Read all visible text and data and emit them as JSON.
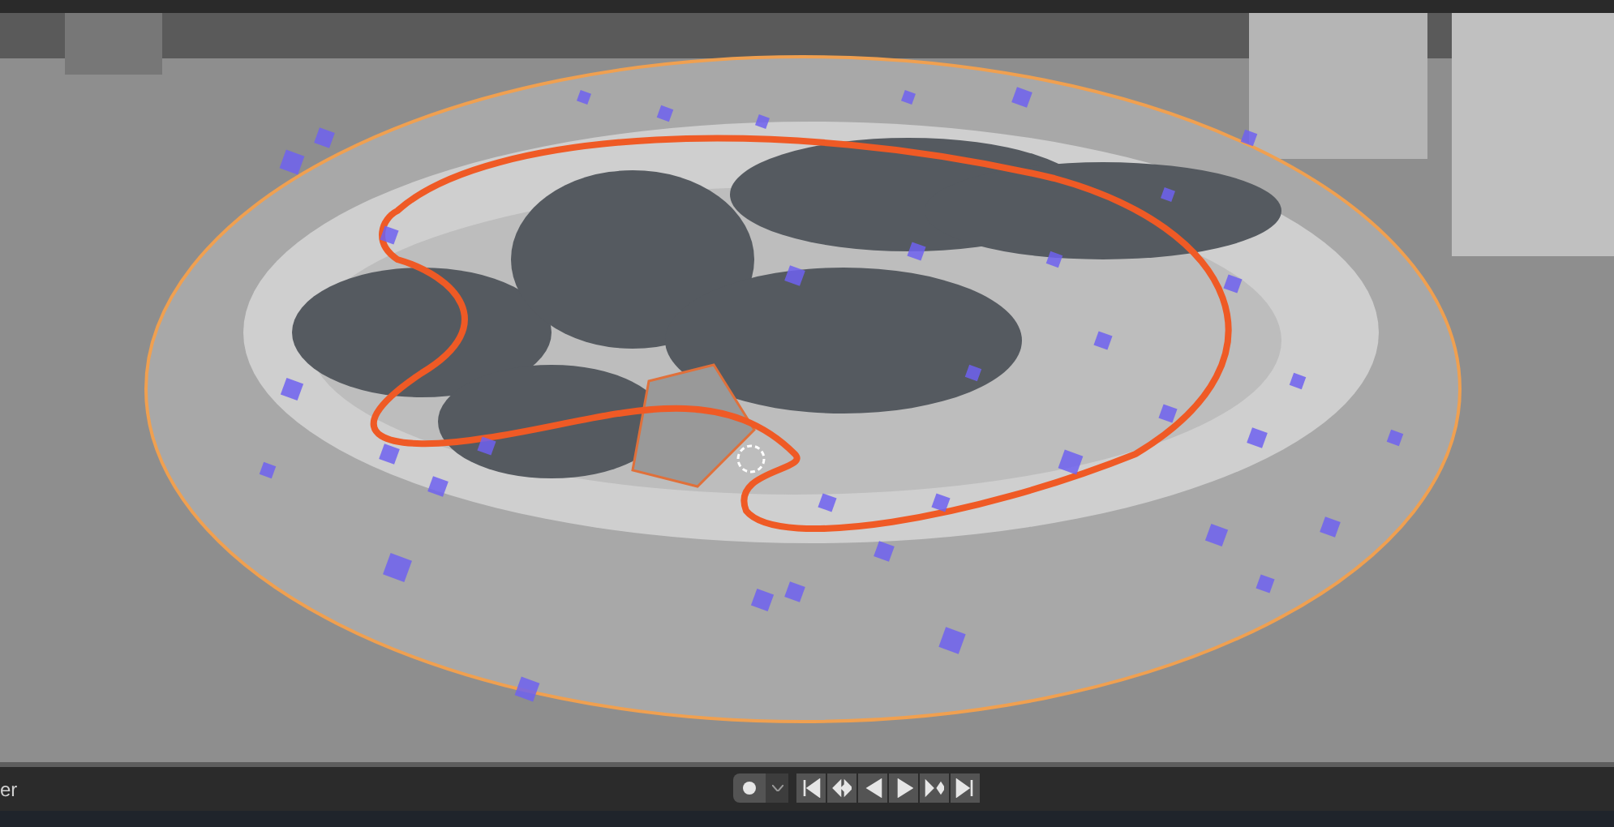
{
  "timeline": {
    "label": "er"
  }
}
